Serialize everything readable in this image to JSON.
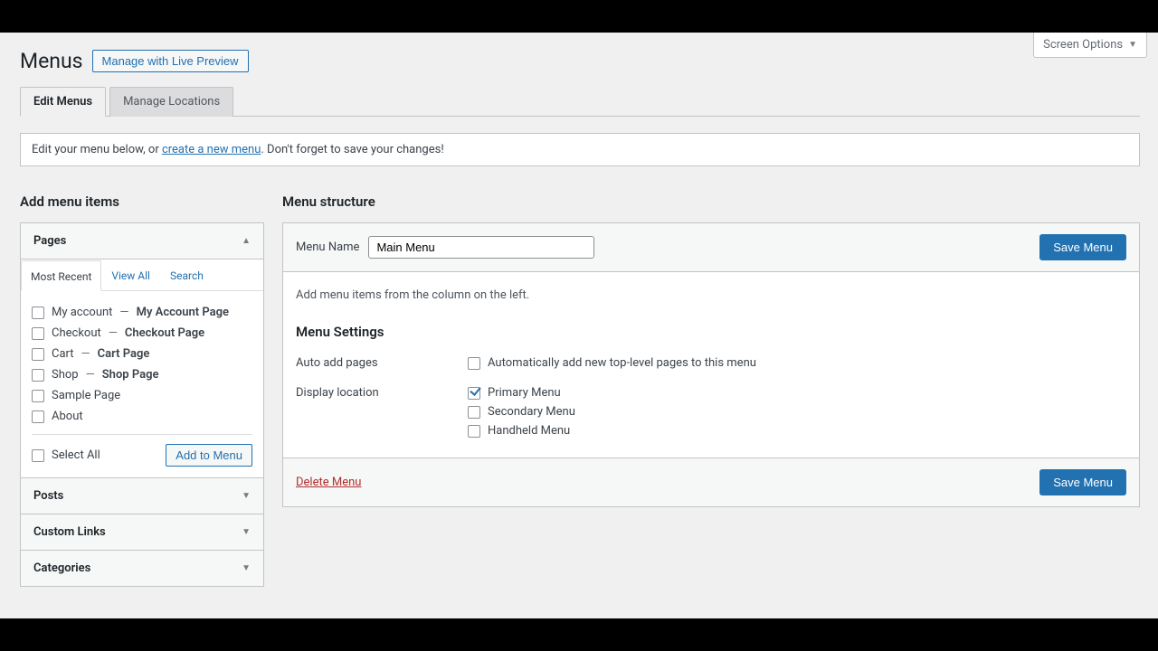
{
  "page": {
    "title": "Menus",
    "live_preview": "Manage with Live Preview",
    "screen_options": "Screen Options"
  },
  "tabs": {
    "edit": "Edit Menus",
    "locations": "Manage Locations"
  },
  "notice": {
    "before": "Edit your menu below, or ",
    "link": "create a new menu",
    "after": ". Don't forget to save your changes!"
  },
  "left": {
    "heading": "Add menu items",
    "pages_label": "Pages",
    "subtabs": {
      "recent": "Most Recent",
      "view_all": "View All",
      "search": "Search"
    },
    "items": [
      {
        "title": "My account",
        "suffix": "My Account Page"
      },
      {
        "title": "Checkout",
        "suffix": "Checkout Page"
      },
      {
        "title": "Cart",
        "suffix": "Cart Page"
      },
      {
        "title": "Shop",
        "suffix": "Shop Page"
      },
      {
        "title": "Sample Page",
        "suffix": ""
      },
      {
        "title": "About",
        "suffix": ""
      }
    ],
    "select_all": "Select All",
    "add_to_menu": "Add to Menu",
    "posts_label": "Posts",
    "custom_links_label": "Custom Links",
    "categories_label": "Categories"
  },
  "right": {
    "heading": "Menu structure",
    "menu_name_label": "Menu Name",
    "menu_name_value": "Main Menu",
    "save": "Save Menu",
    "body_hint": "Add menu items from the column on the left.",
    "settings_heading": "Menu Settings",
    "auto_add_key": "Auto add pages",
    "auto_add_val": "Automatically add new top-level pages to this menu",
    "display_key": "Display location",
    "loc_primary": "Primary Menu",
    "loc_secondary": "Secondary Menu",
    "loc_handheld": "Handheld Menu",
    "delete": "Delete Menu"
  }
}
